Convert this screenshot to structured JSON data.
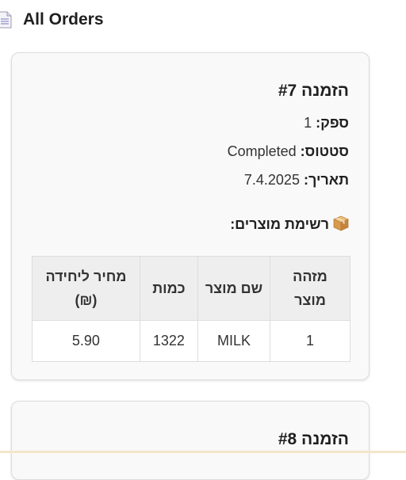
{
  "header": {
    "title": "All Orders",
    "icon": "document-icon"
  },
  "orders": [
    {
      "title": "הזמנה #7",
      "supplier_label": "ספק:",
      "supplier_value": "1",
      "status_label": "סטטוס:",
      "status_value": "Completed",
      "date_label": "תאריך:",
      "date_value": "7.4.2025",
      "products_heading": "רשימת מוצרים:",
      "table": {
        "headers": [
          "מזהה מוצר",
          "שם מוצר",
          "כמות",
          "מחיר ליחידה (₪)"
        ],
        "rows": [
          [
            "1",
            "MILK",
            "1322",
            "5.90"
          ]
        ]
      }
    },
    {
      "title": "הזמנה #8"
    }
  ]
}
